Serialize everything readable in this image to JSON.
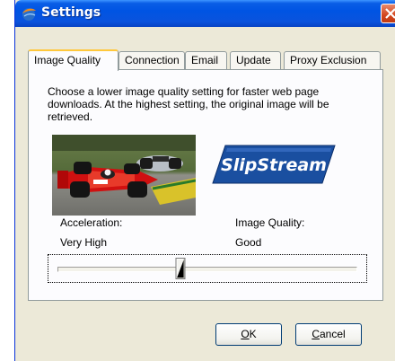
{
  "window": {
    "title": "Settings",
    "icon": "slipstream-orb-icon",
    "close_icon": "close-x-icon"
  },
  "tabs": [
    {
      "label": "Image Quality",
      "active": true
    },
    {
      "label": "Connection",
      "active": false
    },
    {
      "label": "Email",
      "active": false
    },
    {
      "label": "Update",
      "active": false
    },
    {
      "label": "Proxy Exclusion",
      "active": false
    }
  ],
  "panel": {
    "description": "Choose a lower image quality setting for faster web page downloads. At the highest setting, the original image will be retrieved.",
    "logo_text": "SlipStream",
    "acceleration_label": "Acceleration:",
    "acceleration_value": "Very High",
    "image_quality_label": "Image Quality:",
    "image_quality_value": "Good",
    "slider_fraction": 0.41
  },
  "buttons": {
    "ok_mnemonic": "O",
    "ok_rest": "K",
    "cancel_mnemonic": "C",
    "cancel_rest": "ancel"
  },
  "colors": {
    "titlebar": "#0054e3",
    "tab_highlight": "#ffc83c",
    "logo_blue": "#1a4fa0"
  }
}
